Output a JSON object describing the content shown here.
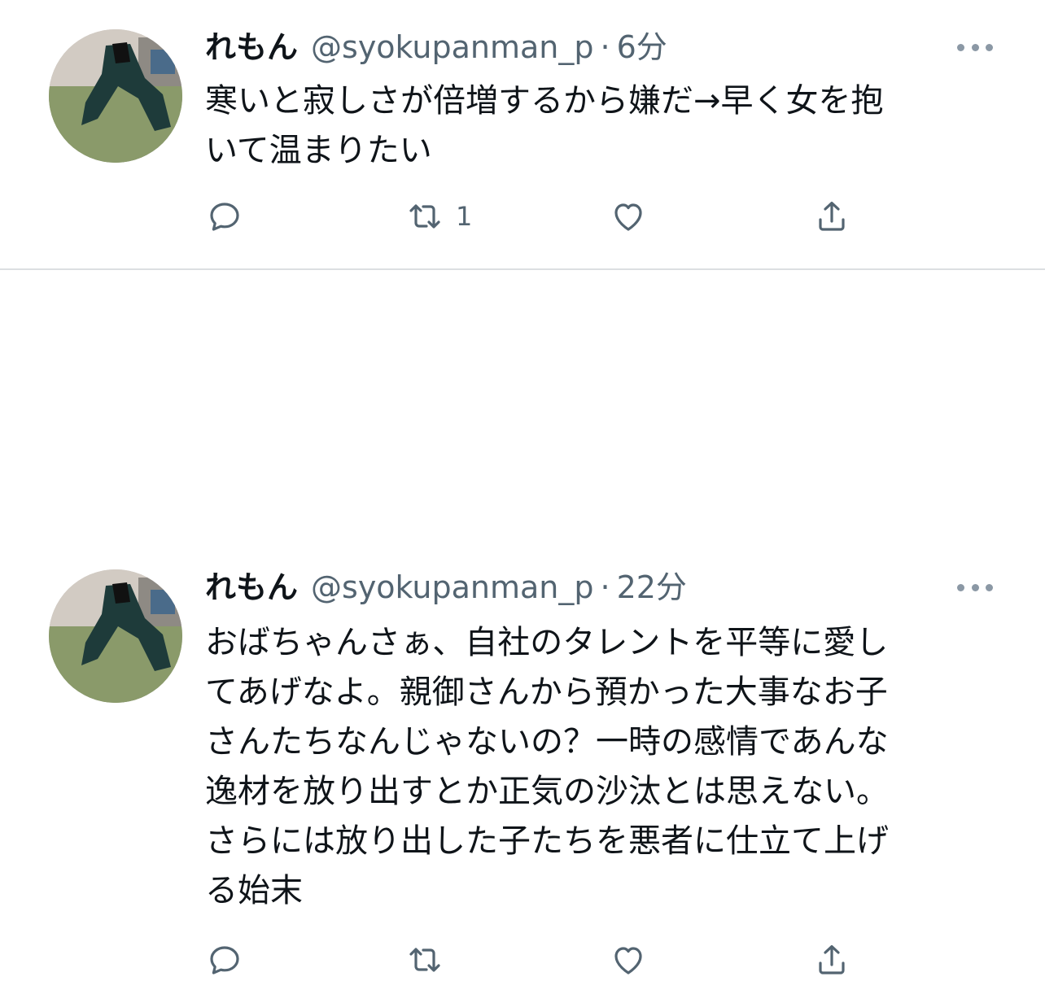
{
  "tweets": [
    {
      "name": "れもん",
      "handle": "@syokupanman_p",
      "separator": "·",
      "time": "6分",
      "lines": [
        "寒いと寂しさが倍増するから嫌だ→早く女を抱",
        "いて温まりたい"
      ],
      "reply_count": "",
      "retweet_count": "1",
      "like_count": ""
    },
    {
      "name": "れもん",
      "handle": "@syokupanman_p",
      "separator": "·",
      "time": "22分",
      "lines": [
        "おばちゃんさぁ、自社のタレントを平等に愛し",
        "てあげなよ。親御さんから預かった大事なお子",
        "さんたちなんじゃないの？一時の感情であんな",
        "逸材を放り出すとか正気の沙汰とは思えない。",
        "さらには放り出した子たちを悪者に仕立て上げ",
        "る始末"
      ],
      "reply_count": "",
      "retweet_count": "",
      "like_count": ""
    }
  ],
  "icons": [
    "reply-icon",
    "retweet-icon",
    "like-icon",
    "share-icon",
    "more-icon"
  ],
  "colors": {
    "text": "#0f1419",
    "secondary": "#536471",
    "divider": "#dcdfe2"
  }
}
